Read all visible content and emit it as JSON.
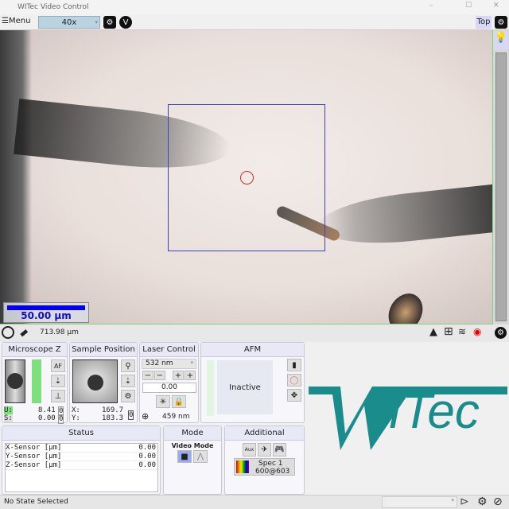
{
  "window": {
    "title": "WITec Video Control"
  },
  "toolbar": {
    "menu_label": "Menu",
    "objective": "40x",
    "top_label": "Top"
  },
  "video": {
    "scale_bar_label": "50.00 µm",
    "accent_box": "#4040c0",
    "target_circle": "#d03030"
  },
  "video_bar": {
    "field_width": "713.98 µm"
  },
  "microscope_z": {
    "title": "Microscope Z",
    "af_label": "AF",
    "u_label": "U:",
    "u_value": "8.41",
    "s_label": "S:",
    "s_value": "0.00",
    "zero": "0"
  },
  "sample_position": {
    "title": "Sample Position",
    "x_label": "X:",
    "x_value": "169.7",
    "y_label": "Y:",
    "y_value": "183.3",
    "zero": "0"
  },
  "laser_control": {
    "title": "Laser Control",
    "wavelength": "532 nm",
    "power": "0.00",
    "spot": "459 nm"
  },
  "afm": {
    "title": "AFM",
    "state": "Inactive"
  },
  "status": {
    "title": "Status",
    "rows": [
      {
        "label": "X-Sensor [µm]",
        "value": "0.00"
      },
      {
        "label": "Y-Sensor [µm]",
        "value": "0.00"
      },
      {
        "label": "Z-Sensor [µm]",
        "value": "0.00"
      }
    ]
  },
  "mode": {
    "title": "Mode",
    "label": "Video Mode"
  },
  "additional": {
    "title": "Additional",
    "aux": "Aux",
    "spec_line1": "Spec 1",
    "spec_line2": "600@603"
  },
  "logo": {
    "text": "WITec",
    "color": "#1a8c8c"
  },
  "statusbar": {
    "state": "No State Selected"
  }
}
